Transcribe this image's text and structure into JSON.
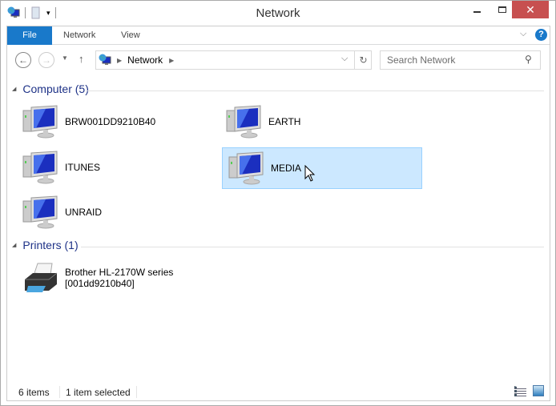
{
  "window": {
    "title": "Network",
    "close": "✕"
  },
  "ribbon": {
    "tabs": [
      "File",
      "Network",
      "View"
    ]
  },
  "address": {
    "path": "Network",
    "search_placeholder": "Search Network"
  },
  "groups": {
    "computer": {
      "label": "Computer (5)",
      "items": [
        "BRW001DD9210B40",
        "EARTH",
        "ITUNES",
        "MEDIA",
        "UNRAID"
      ],
      "selected": "MEDIA"
    },
    "printers": {
      "label": "Printers (1)",
      "items": [
        {
          "name": "Brother HL-2170W series",
          "sub": "[001dd9210b40]"
        }
      ]
    }
  },
  "status": {
    "count": "6 items",
    "selected": "1 item selected"
  },
  "colors": {
    "accent": "#1979ca",
    "close": "#c75050",
    "group": "#1e3287",
    "selection": "#cce8ff"
  }
}
